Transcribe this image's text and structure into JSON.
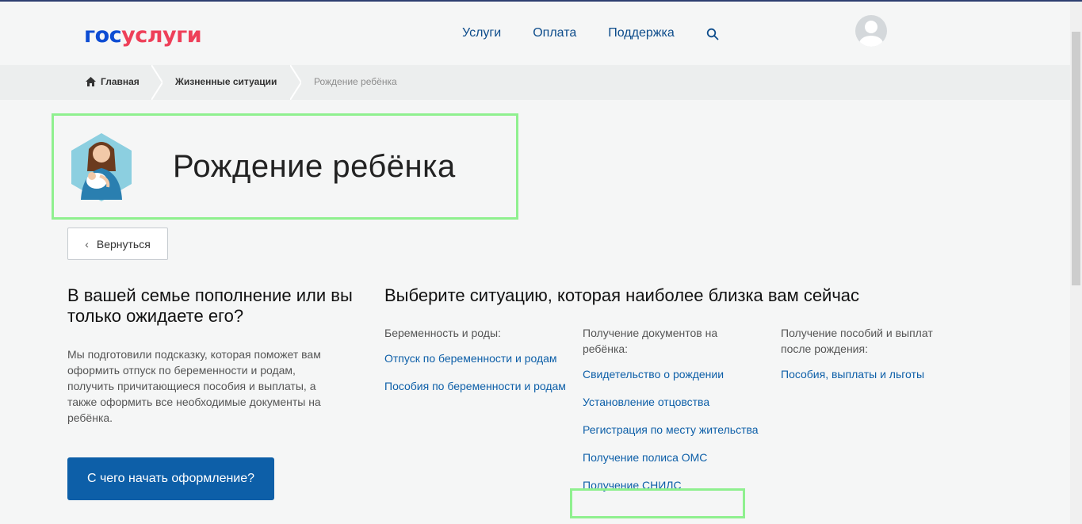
{
  "header": {
    "logo_part1": "гос",
    "logo_part2": "услуги",
    "nav": [
      "Услуги",
      "Оплата",
      "Поддержка"
    ],
    "search_icon": "search-icon",
    "avatar_icon": "user-avatar-icon"
  },
  "breadcrumbs": {
    "home": "Главная",
    "middle": "Жизненные ситуации",
    "current": "Рождение ребёнка"
  },
  "hero": {
    "title": "Рождение ребёнка",
    "icon": "mother-with-baby-icon"
  },
  "back_button": "Вернуться",
  "left": {
    "title": "В вашей семье пополнение или вы только ожидаете его?",
    "text": "Мы подготовили подсказку, которая поможет вам оформить отпуск по беременности и родам, получить причитающиеся пособия и выплаты, а также оформить все необходимые документы на ребёнка.",
    "start_button": "С чего начать оформление?"
  },
  "right": {
    "title": "Выберите ситуацию, которая наиболее близка вам сейчас",
    "columns": [
      {
        "heading": "Беременность и роды:",
        "links": [
          "Отпуск по беременности и родам",
          "Пособия по беременности и родам"
        ]
      },
      {
        "heading": "Получение документов на ребёнка:",
        "links": [
          "Свидетельство о рождении",
          "Установление отцовства",
          "Регистрация по месту жительства",
          "Получение полиса ОМС",
          "Получение СНИЛС"
        ]
      },
      {
        "heading": "Получение пособий и выплат после рождения:",
        "links": [
          "Пособия, выплаты и льготы"
        ]
      }
    ]
  },
  "colors": {
    "link": "#0d5fa8",
    "primary_button": "#0d5fa8",
    "highlight": "#8ff08f",
    "logo_blue": "#0d4cd3",
    "logo_red": "#ee3f58"
  }
}
